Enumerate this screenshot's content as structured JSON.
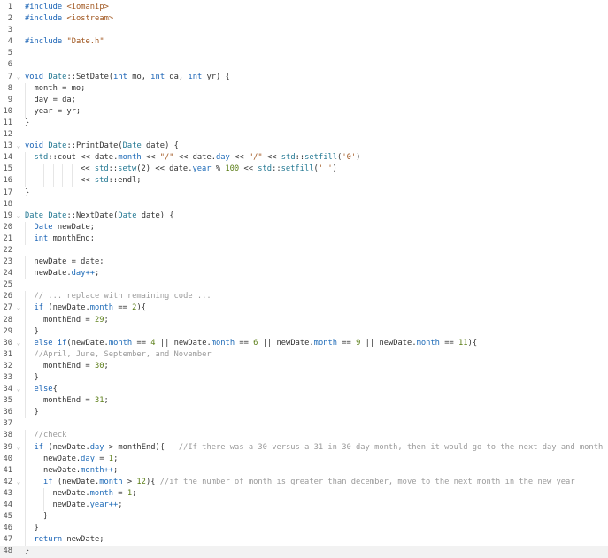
{
  "editor": {
    "current_line": 48,
    "lines": [
      {
        "n": 1,
        "tokens": [
          [
            "pp",
            "#include"
          ],
          [
            "p",
            " "
          ],
          [
            "s",
            "<iomanip>"
          ]
        ]
      },
      {
        "n": 2,
        "tokens": [
          [
            "pp",
            "#include"
          ],
          [
            "p",
            " "
          ],
          [
            "s",
            "<iostream>"
          ]
        ]
      },
      {
        "n": 3,
        "tokens": []
      },
      {
        "n": 4,
        "tokens": [
          [
            "pp",
            "#include"
          ],
          [
            "p",
            " "
          ],
          [
            "s",
            "\"Date.h\""
          ]
        ]
      },
      {
        "n": 5,
        "tokens": []
      },
      {
        "n": 6,
        "tokens": []
      },
      {
        "n": 7,
        "fold": true,
        "tokens": [
          [
            "k",
            "void"
          ],
          [
            "p",
            " "
          ],
          [
            "t",
            "Date"
          ],
          [
            "p",
            "::SetDate("
          ],
          [
            "k",
            "int"
          ],
          [
            "p",
            " mo, "
          ],
          [
            "k",
            "int"
          ],
          [
            "p",
            " da, "
          ],
          [
            "k",
            "int"
          ],
          [
            "p",
            " yr) {"
          ]
        ]
      },
      {
        "n": 8,
        "tokens": [
          [
            "p",
            "  month = mo;"
          ]
        ]
      },
      {
        "n": 9,
        "tokens": [
          [
            "p",
            "  day = da;"
          ]
        ]
      },
      {
        "n": 10,
        "tokens": [
          [
            "p",
            "  year = yr;"
          ]
        ]
      },
      {
        "n": 11,
        "tokens": [
          [
            "p",
            "}"
          ]
        ]
      },
      {
        "n": 12,
        "tokens": []
      },
      {
        "n": 13,
        "fold": true,
        "tokens": [
          [
            "k",
            "void"
          ],
          [
            "p",
            " "
          ],
          [
            "t",
            "Date"
          ],
          [
            "p",
            "::PrintDate("
          ],
          [
            "t",
            "Date"
          ],
          [
            "p",
            " date) {"
          ]
        ]
      },
      {
        "n": 14,
        "tokens": [
          [
            "p",
            "  "
          ],
          [
            "t",
            "std"
          ],
          [
            "p",
            "::cout << date."
          ],
          [
            "m",
            "month"
          ],
          [
            "p",
            " << "
          ],
          [
            "s",
            "\"/\""
          ],
          [
            "p",
            " << date."
          ],
          [
            "m",
            "day"
          ],
          [
            "p",
            " << "
          ],
          [
            "s",
            "\"/\""
          ],
          [
            "p",
            " << "
          ],
          [
            "t",
            "std"
          ],
          [
            "p",
            "::"
          ],
          [
            "t",
            "setfill"
          ],
          [
            "p",
            "("
          ],
          [
            "s",
            "'0'"
          ],
          [
            "p",
            ")"
          ]
        ]
      },
      {
        "n": 15,
        "tokens": [
          [
            "p",
            "            << "
          ],
          [
            "t",
            "std"
          ],
          [
            "p",
            "::"
          ],
          [
            "t",
            "setw"
          ],
          [
            "p",
            "(2) << date."
          ],
          [
            "m",
            "year"
          ],
          [
            "p",
            " % "
          ],
          [
            "n",
            "100"
          ],
          [
            "p",
            " << "
          ],
          [
            "t",
            "std"
          ],
          [
            "p",
            "::"
          ],
          [
            "t",
            "setfill"
          ],
          [
            "p",
            "("
          ],
          [
            "s",
            "' '"
          ],
          [
            "p",
            ")"
          ]
        ]
      },
      {
        "n": 16,
        "tokens": [
          [
            "p",
            "            << "
          ],
          [
            "t",
            "std"
          ],
          [
            "p",
            "::endl;"
          ]
        ]
      },
      {
        "n": 17,
        "tokens": [
          [
            "p",
            "}"
          ]
        ]
      },
      {
        "n": 18,
        "tokens": []
      },
      {
        "n": 19,
        "fold": true,
        "tokens": [
          [
            "t",
            "Date"
          ],
          [
            "p",
            " "
          ],
          [
            "t",
            "Date"
          ],
          [
            "p",
            "::NextDate("
          ],
          [
            "t",
            "Date"
          ],
          [
            "p",
            " date) {"
          ]
        ]
      },
      {
        "n": 20,
        "tokens": [
          [
            "p",
            "  "
          ],
          [
            "k",
            "Date"
          ],
          [
            "p",
            " newDate;"
          ]
        ]
      },
      {
        "n": 21,
        "tokens": [
          [
            "p",
            "  "
          ],
          [
            "k",
            "int"
          ],
          [
            "p",
            " monthEnd;"
          ]
        ]
      },
      {
        "n": 22,
        "tokens": []
      },
      {
        "n": 23,
        "tokens": [
          [
            "p",
            "  newDate = date;"
          ]
        ]
      },
      {
        "n": 24,
        "tokens": [
          [
            "p",
            "  newDate."
          ],
          [
            "m",
            "day++"
          ],
          [
            "p",
            ";"
          ]
        ]
      },
      {
        "n": 25,
        "tokens": []
      },
      {
        "n": 26,
        "tokens": [
          [
            "p",
            "  "
          ],
          [
            "c",
            "// ... replace with remaining code ..."
          ]
        ]
      },
      {
        "n": 27,
        "fold": true,
        "tokens": [
          [
            "p",
            "  "
          ],
          [
            "k",
            "if"
          ],
          [
            "p",
            " (newDate."
          ],
          [
            "m",
            "month"
          ],
          [
            "p",
            " == "
          ],
          [
            "n",
            "2"
          ],
          [
            "p",
            "){"
          ]
        ]
      },
      {
        "n": 28,
        "tokens": [
          [
            "p",
            "    monthEnd = "
          ],
          [
            "n",
            "29"
          ],
          [
            "p",
            ";"
          ]
        ]
      },
      {
        "n": 29,
        "tokens": [
          [
            "p",
            "  }"
          ]
        ]
      },
      {
        "n": 30,
        "fold": true,
        "tokens": [
          [
            "p",
            "  "
          ],
          [
            "k",
            "else"
          ],
          [
            "p",
            " "
          ],
          [
            "k",
            "if"
          ],
          [
            "p",
            "(newDate."
          ],
          [
            "m",
            "month"
          ],
          [
            "p",
            " == "
          ],
          [
            "n",
            "4"
          ],
          [
            "p",
            " || newDate."
          ],
          [
            "m",
            "month"
          ],
          [
            "p",
            " == "
          ],
          [
            "n",
            "6"
          ],
          [
            "p",
            " || newDate."
          ],
          [
            "m",
            "month"
          ],
          [
            "p",
            " == "
          ],
          [
            "n",
            "9"
          ],
          [
            "p",
            " || newDate."
          ],
          [
            "m",
            "month"
          ],
          [
            "p",
            " == "
          ],
          [
            "n",
            "11"
          ],
          [
            "p",
            "){"
          ]
        ]
      },
      {
        "n": 31,
        "tokens": [
          [
            "p",
            "  "
          ],
          [
            "c",
            "//April, June, September, and November"
          ]
        ]
      },
      {
        "n": 32,
        "tokens": [
          [
            "p",
            "    monthEnd = "
          ],
          [
            "n",
            "30"
          ],
          [
            "p",
            ";"
          ]
        ]
      },
      {
        "n": 33,
        "tokens": [
          [
            "p",
            "  }"
          ]
        ]
      },
      {
        "n": 34,
        "fold": true,
        "tokens": [
          [
            "p",
            "  "
          ],
          [
            "k",
            "else"
          ],
          [
            "p",
            "{"
          ]
        ]
      },
      {
        "n": 35,
        "tokens": [
          [
            "p",
            "    monthEnd = "
          ],
          [
            "n",
            "31"
          ],
          [
            "p",
            ";"
          ]
        ]
      },
      {
        "n": 36,
        "tokens": [
          [
            "p",
            "  }"
          ]
        ]
      },
      {
        "n": 37,
        "tokens": []
      },
      {
        "n": 38,
        "tokens": [
          [
            "p",
            "  "
          ],
          [
            "c",
            "//check"
          ]
        ]
      },
      {
        "n": 39,
        "fold": true,
        "tokens": [
          [
            "p",
            "  "
          ],
          [
            "k",
            "if"
          ],
          [
            "p",
            " (newDate."
          ],
          [
            "m",
            "day"
          ],
          [
            "p",
            " > monthEnd){   "
          ],
          [
            "c",
            "//If there was a 30 versus a 31 in 30 day month, then it would go to the next day and month"
          ]
        ]
      },
      {
        "n": 40,
        "tokens": [
          [
            "p",
            "    newDate."
          ],
          [
            "m",
            "day"
          ],
          [
            "p",
            " = "
          ],
          [
            "n",
            "1"
          ],
          [
            "p",
            ";"
          ]
        ]
      },
      {
        "n": 41,
        "tokens": [
          [
            "p",
            "    newDate."
          ],
          [
            "m",
            "month++"
          ],
          [
            "p",
            ";"
          ]
        ]
      },
      {
        "n": 42,
        "fold": true,
        "tokens": [
          [
            "p",
            "    "
          ],
          [
            "k",
            "if"
          ],
          [
            "p",
            " (newDate."
          ],
          [
            "m",
            "month"
          ],
          [
            "p",
            " > "
          ],
          [
            "n",
            "12"
          ],
          [
            "p",
            "){ "
          ],
          [
            "c",
            "//if the number of month is greater than december, move to the next month in the new year"
          ]
        ]
      },
      {
        "n": 43,
        "tokens": [
          [
            "p",
            "      newDate."
          ],
          [
            "m",
            "month"
          ],
          [
            "p",
            " = "
          ],
          [
            "n",
            "1"
          ],
          [
            "p",
            ";"
          ]
        ]
      },
      {
        "n": 44,
        "tokens": [
          [
            "p",
            "      newDate."
          ],
          [
            "m",
            "year++"
          ],
          [
            "p",
            ";"
          ]
        ]
      },
      {
        "n": 45,
        "tokens": [
          [
            "p",
            "    }"
          ]
        ]
      },
      {
        "n": 46,
        "tokens": [
          [
            "p",
            "  }"
          ]
        ]
      },
      {
        "n": 47,
        "tokens": [
          [
            "p",
            "  "
          ],
          [
            "k",
            "return"
          ],
          [
            "p",
            " newDate;"
          ]
        ]
      },
      {
        "n": 48,
        "tokens": [
          [
            "p",
            "}"
          ]
        ]
      }
    ]
  },
  "icons": {
    "fold": "chevron-down-icon",
    "fold_glyph": "⌄"
  }
}
